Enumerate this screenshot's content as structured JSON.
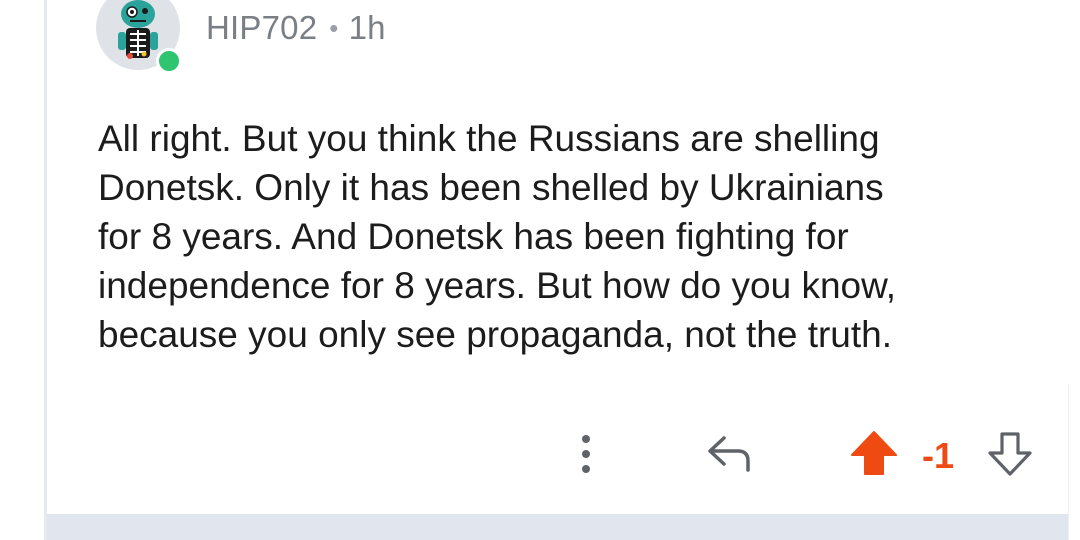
{
  "comment": {
    "username": "HIP702",
    "separator": "•",
    "time": "1h",
    "body": "All right.  But you think the Russians are shelling\nDonetsk.  Only it has been shelled by Ukrainians\nfor 8 years.  And Donetsk has been fighting for\nindependence for 8 years.  But how do you know,\nbecause you only see propaganda, not the truth.",
    "vote_count": "-1",
    "vote_state": "upvoted"
  },
  "colors": {
    "upvote_active": "#f04a13",
    "online_status": "#2fc470",
    "text": "#1c1c1c",
    "meta": "#7a7f86"
  },
  "icons": {
    "more": "more-vertical-icon",
    "reply": "reply-icon",
    "upvote": "upvote-arrow-icon",
    "downvote": "downvote-arrow-icon"
  }
}
